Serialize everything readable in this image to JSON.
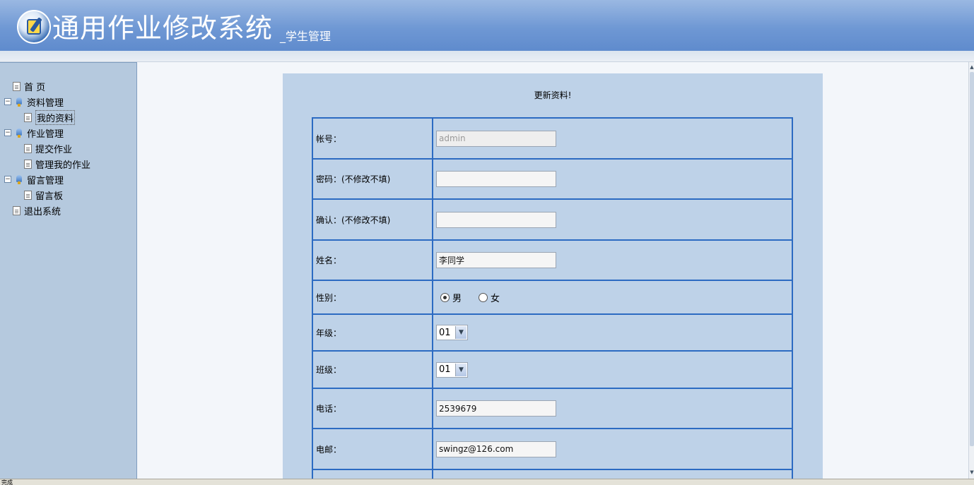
{
  "header": {
    "title": "通用作业修改系统",
    "subtitle": "_学生管理"
  },
  "sidebar": {
    "items": [
      {
        "label": "首 页",
        "icon": "page-icon",
        "level": 0
      },
      {
        "label": "资料管理",
        "icon": "folder-icon",
        "level": 0,
        "expanded": true
      },
      {
        "label": "我的资料",
        "icon": "page-icon",
        "level": 1,
        "selected": true
      },
      {
        "label": "作业管理",
        "icon": "folder-icon",
        "level": 0,
        "expanded": true
      },
      {
        "label": "提交作业",
        "icon": "page-icon",
        "level": 1
      },
      {
        "label": "管理我的作业",
        "icon": "page-icon",
        "level": 1
      },
      {
        "label": "留言管理",
        "icon": "folder-icon",
        "level": 0,
        "expanded": true
      },
      {
        "label": "留言板",
        "icon": "page-icon",
        "level": 1
      },
      {
        "label": "退出系统",
        "icon": "page-icon",
        "level": 0
      }
    ]
  },
  "form": {
    "title": "更新资料!",
    "account_label": "帐号：",
    "account_value": "admin",
    "password_label": "密码：(不修改不填)",
    "password_value": "",
    "confirm_label": "确认：(不修改不填)",
    "confirm_value": "",
    "name_label": "姓名：",
    "name_value": "李同学",
    "gender_label": "性别：",
    "gender_options": [
      "男",
      "女"
    ],
    "gender_selected": "男",
    "grade_label": "年级：",
    "grade_value": "01",
    "class_label": "班级：",
    "class_value": "01",
    "phone_label": "电话：",
    "phone_value": "2539679",
    "email_label": "电邮：",
    "email_value": "swingz@126.com"
  },
  "statusbar": {
    "text": "完成"
  },
  "colors": {
    "header": "#6f98d4",
    "sidebar": "#b5c9de",
    "panel": "#bed2e8",
    "table_border": "#2c6bc2"
  }
}
